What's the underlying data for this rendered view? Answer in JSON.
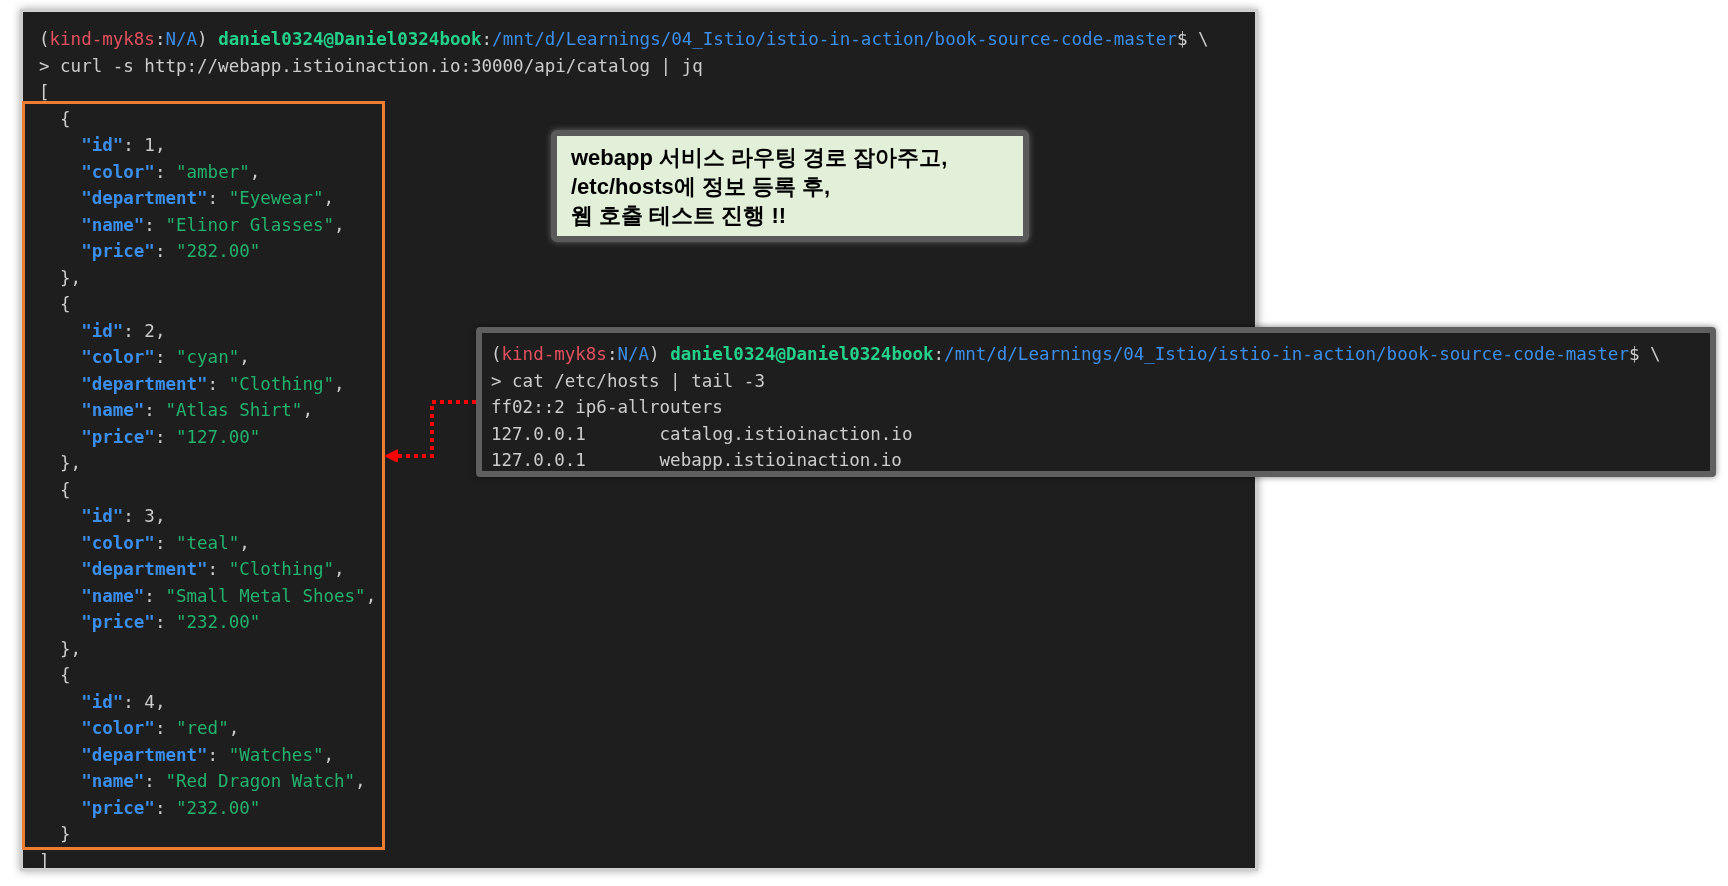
{
  "main_terminal": {
    "lines": [
      [
        {
          "kind": "paren",
          "text": "("
        },
        {
          "kind": "context",
          "text": "kind-myk8s"
        },
        {
          "kind": "plain",
          "text": ":"
        },
        {
          "kind": "namespace",
          "text": "N/A"
        },
        {
          "kind": "paren",
          "text": ") "
        },
        {
          "kind": "user",
          "text": "daniel0324@Daniel0324book"
        },
        {
          "kind": "plain",
          "text": ":"
        },
        {
          "kind": "path",
          "text": "/mnt/d/Learnings/04_Istio/istio-in-action/book-source-code-master"
        },
        {
          "kind": "plain",
          "text": "$ \\"
        }
      ],
      [
        {
          "kind": "plain",
          "text": "> curl -s http://webapp.istioinaction.io:30000/api/catalog | jq"
        }
      ],
      [
        {
          "kind": "plain",
          "text": "["
        }
      ],
      [
        {
          "kind": "plain",
          "text": "  {"
        }
      ],
      [
        {
          "kind": "key",
          "text": "    \"id\""
        },
        {
          "kind": "plain",
          "text": ": 1,"
        }
      ],
      [
        {
          "kind": "key",
          "text": "    \"color\""
        },
        {
          "kind": "plain",
          "text": ": "
        },
        {
          "kind": "string",
          "text": "\"amber\""
        },
        {
          "kind": "plain",
          "text": ","
        }
      ],
      [
        {
          "kind": "key",
          "text": "    \"department\""
        },
        {
          "kind": "plain",
          "text": ": "
        },
        {
          "kind": "string",
          "text": "\"Eyewear\""
        },
        {
          "kind": "plain",
          "text": ","
        }
      ],
      [
        {
          "kind": "key",
          "text": "    \"name\""
        },
        {
          "kind": "plain",
          "text": ": "
        },
        {
          "kind": "string",
          "text": "\"Elinor Glasses\""
        },
        {
          "kind": "plain",
          "text": ","
        }
      ],
      [
        {
          "kind": "key",
          "text": "    \"price\""
        },
        {
          "kind": "plain",
          "text": ": "
        },
        {
          "kind": "string",
          "text": "\"282.00\""
        }
      ],
      [
        {
          "kind": "plain",
          "text": "  },"
        }
      ],
      [
        {
          "kind": "plain",
          "text": "  {"
        }
      ],
      [
        {
          "kind": "key",
          "text": "    \"id\""
        },
        {
          "kind": "plain",
          "text": ": 2,"
        }
      ],
      [
        {
          "kind": "key",
          "text": "    \"color\""
        },
        {
          "kind": "plain",
          "text": ": "
        },
        {
          "kind": "string",
          "text": "\"cyan\""
        },
        {
          "kind": "plain",
          "text": ","
        }
      ],
      [
        {
          "kind": "key",
          "text": "    \"department\""
        },
        {
          "kind": "plain",
          "text": ": "
        },
        {
          "kind": "string",
          "text": "\"Clothing\""
        },
        {
          "kind": "plain",
          "text": ","
        }
      ],
      [
        {
          "kind": "key",
          "text": "    \"name\""
        },
        {
          "kind": "plain",
          "text": ": "
        },
        {
          "kind": "string",
          "text": "\"Atlas Shirt\""
        },
        {
          "kind": "plain",
          "text": ","
        }
      ],
      [
        {
          "kind": "key",
          "text": "    \"price\""
        },
        {
          "kind": "plain",
          "text": ": "
        },
        {
          "kind": "string",
          "text": "\"127.00\""
        }
      ],
      [
        {
          "kind": "plain",
          "text": "  },"
        }
      ],
      [
        {
          "kind": "plain",
          "text": "  {"
        }
      ],
      [
        {
          "kind": "key",
          "text": "    \"id\""
        },
        {
          "kind": "plain",
          "text": ": 3,"
        }
      ],
      [
        {
          "kind": "key",
          "text": "    \"color\""
        },
        {
          "kind": "plain",
          "text": ": "
        },
        {
          "kind": "string",
          "text": "\"teal\""
        },
        {
          "kind": "plain",
          "text": ","
        }
      ],
      [
        {
          "kind": "key",
          "text": "    \"department\""
        },
        {
          "kind": "plain",
          "text": ": "
        },
        {
          "kind": "string",
          "text": "\"Clothing\""
        },
        {
          "kind": "plain",
          "text": ","
        }
      ],
      [
        {
          "kind": "key",
          "text": "    \"name\""
        },
        {
          "kind": "plain",
          "text": ": "
        },
        {
          "kind": "string",
          "text": "\"Small Metal Shoes\""
        },
        {
          "kind": "plain",
          "text": ","
        }
      ],
      [
        {
          "kind": "key",
          "text": "    \"price\""
        },
        {
          "kind": "plain",
          "text": ": "
        },
        {
          "kind": "string",
          "text": "\"232.00\""
        }
      ],
      [
        {
          "kind": "plain",
          "text": "  },"
        }
      ],
      [
        {
          "kind": "plain",
          "text": "  {"
        }
      ],
      [
        {
          "kind": "key",
          "text": "    \"id\""
        },
        {
          "kind": "plain",
          "text": ": 4,"
        }
      ],
      [
        {
          "kind": "key",
          "text": "    \"color\""
        },
        {
          "kind": "plain",
          "text": ": "
        },
        {
          "kind": "string",
          "text": "\"red\""
        },
        {
          "kind": "plain",
          "text": ","
        }
      ],
      [
        {
          "kind": "key",
          "text": "    \"department\""
        },
        {
          "kind": "plain",
          "text": ": "
        },
        {
          "kind": "string",
          "text": "\"Watches\""
        },
        {
          "kind": "plain",
          "text": ","
        }
      ],
      [
        {
          "kind": "key",
          "text": "    \"name\""
        },
        {
          "kind": "plain",
          "text": ": "
        },
        {
          "kind": "string",
          "text": "\"Red Dragon Watch\""
        },
        {
          "kind": "plain",
          "text": ","
        }
      ],
      [
        {
          "kind": "key",
          "text": "    \"price\""
        },
        {
          "kind": "plain",
          "text": ": "
        },
        {
          "kind": "string",
          "text": "\"232.00\""
        }
      ],
      [
        {
          "kind": "plain",
          "text": "  }"
        }
      ],
      [
        {
          "kind": "plain",
          "text": "]"
        }
      ]
    ]
  },
  "callout": {
    "lines": [
      "webapp 서비스 라우팅 경로 잡아주고,",
      "/etc/hosts에 정보 등록 후,",
      "웹 호출 테스트 진행 !!"
    ]
  },
  "hosts_terminal": {
    "lines": [
      [
        {
          "kind": "paren",
          "text": "("
        },
        {
          "kind": "context",
          "text": "kind-myk8s"
        },
        {
          "kind": "plain",
          "text": ":"
        },
        {
          "kind": "namespace",
          "text": "N/A"
        },
        {
          "kind": "paren",
          "text": ") "
        },
        {
          "kind": "user",
          "text": "daniel0324@Daniel0324book"
        },
        {
          "kind": "plain",
          "text": ":"
        },
        {
          "kind": "path",
          "text": "/mnt/d/Learnings/04_Istio/istio-in-action/book-source-code-master"
        },
        {
          "kind": "plain",
          "text": "$ \\"
        }
      ],
      [
        {
          "kind": "plain",
          "text": "> cat /etc/hosts | tail -3"
        }
      ],
      [
        {
          "kind": "plain",
          "text": "ff02::2 ip6-allrouters"
        }
      ],
      [
        {
          "kind": "plain",
          "text": "127.0.0.1       catalog.istioinaction.io"
        }
      ],
      [
        {
          "kind": "plain",
          "text": "127.0.0.1       webapp.istioinaction.io"
        }
      ]
    ]
  }
}
